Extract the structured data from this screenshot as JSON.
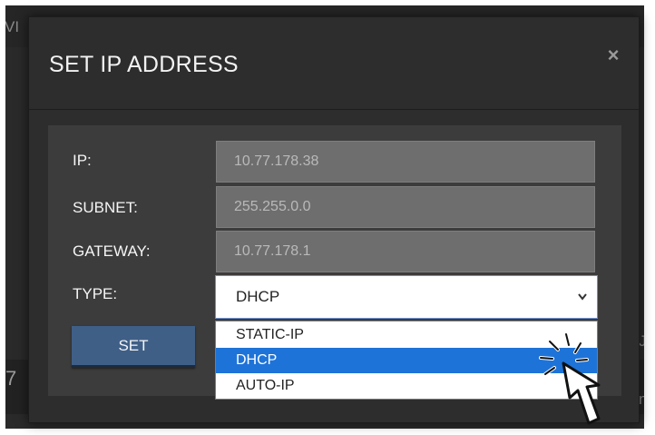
{
  "background": {
    "left_partial_text": "VI",
    "left_partial_number": "7",
    "right_partial_text_1": "JS",
    "right_partial_text_2": "n"
  },
  "modal": {
    "title": "SET IP ADDRESS",
    "close_glyph": "×",
    "fields": [
      {
        "label": "IP:",
        "value": "10.77.178.38"
      },
      {
        "label": "SUBNET:",
        "value": "255.255.0.0"
      },
      {
        "label": "GATEWAY:",
        "value": "10.77.178.1"
      }
    ],
    "type": {
      "label": "TYPE:",
      "selected": "DHCP",
      "chevron": "⌄",
      "options": [
        "STATIC-IP",
        "DHCP",
        "AUTO-IP"
      ],
      "highlighted_option": "DHCP"
    },
    "set_button": "SET"
  },
  "colors": {
    "accent": "#1e73d8",
    "button": "#3f5f87"
  },
  "icons": {
    "cursor": "hand-pointer-icon",
    "close": "close-icon",
    "chevron": "chevron-down-icon"
  }
}
